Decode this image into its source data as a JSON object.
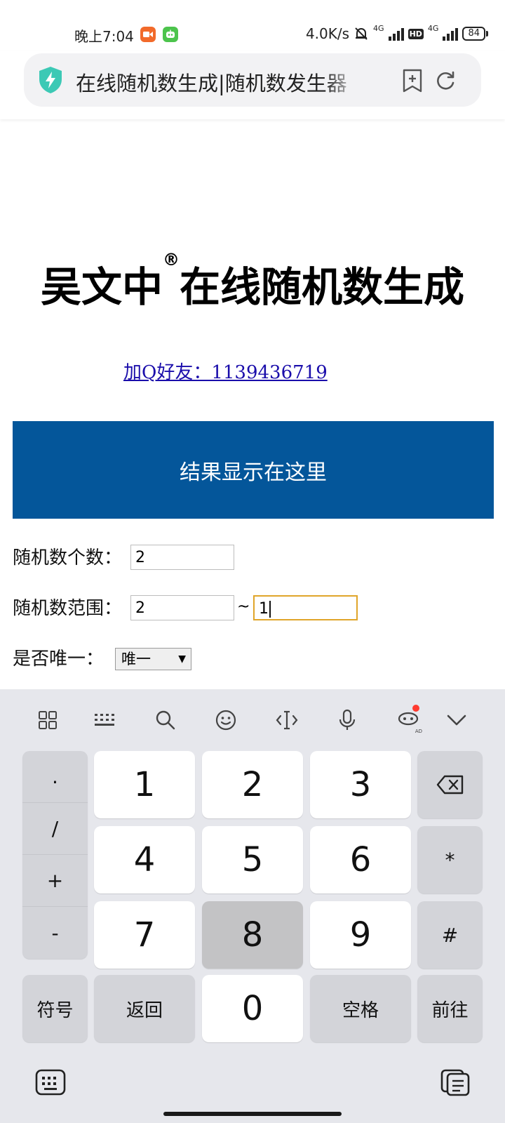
{
  "status_bar": {
    "time": "晚上7:04",
    "net_speed": "4.0K/s",
    "sim1_label": "4G",
    "sim2_label": "4G",
    "hd_label": "HD",
    "battery": "84"
  },
  "browser": {
    "tab_title": "在线随机数生成|随机数发生器"
  },
  "page": {
    "title_before_mark": "吴文中",
    "title_mark": "®",
    "title_after_mark": "在线随机数生成",
    "qq_link": "加Q好友：1139436719",
    "result_placeholder": "结果显示在这里",
    "count_label": "随机数个数：",
    "count_value": "2",
    "range_label": "随机数范围：",
    "range_min": "2",
    "range_separator": "~",
    "range_max": "1",
    "unique_label": "是否唯一：",
    "unique_selected": "唯一"
  },
  "keyboard": {
    "symbols": [
      ".",
      "/",
      "+",
      "-"
    ],
    "digits": [
      "1",
      "2",
      "3",
      "4",
      "5",
      "6",
      "7",
      "8",
      "9",
      "0"
    ],
    "star": "*",
    "hash": "#",
    "symbol_key": "符号",
    "back_key": "返回",
    "space_key": "空格",
    "go_key": "前往",
    "pressed_key": "8",
    "ai_badge": "AD",
    "toolbar_icons": [
      "grid-icon",
      "keyboard-layout-icon",
      "search-icon",
      "emoji-icon",
      "cursor-icon",
      "microphone-icon",
      "ai-assistant-icon",
      "collapse-keyboard-icon"
    ]
  },
  "colors": {
    "result_bg": "#04569a",
    "link": "#1a0dab",
    "focus_border": "#e0a52a",
    "shield": "#3cc9b5"
  }
}
